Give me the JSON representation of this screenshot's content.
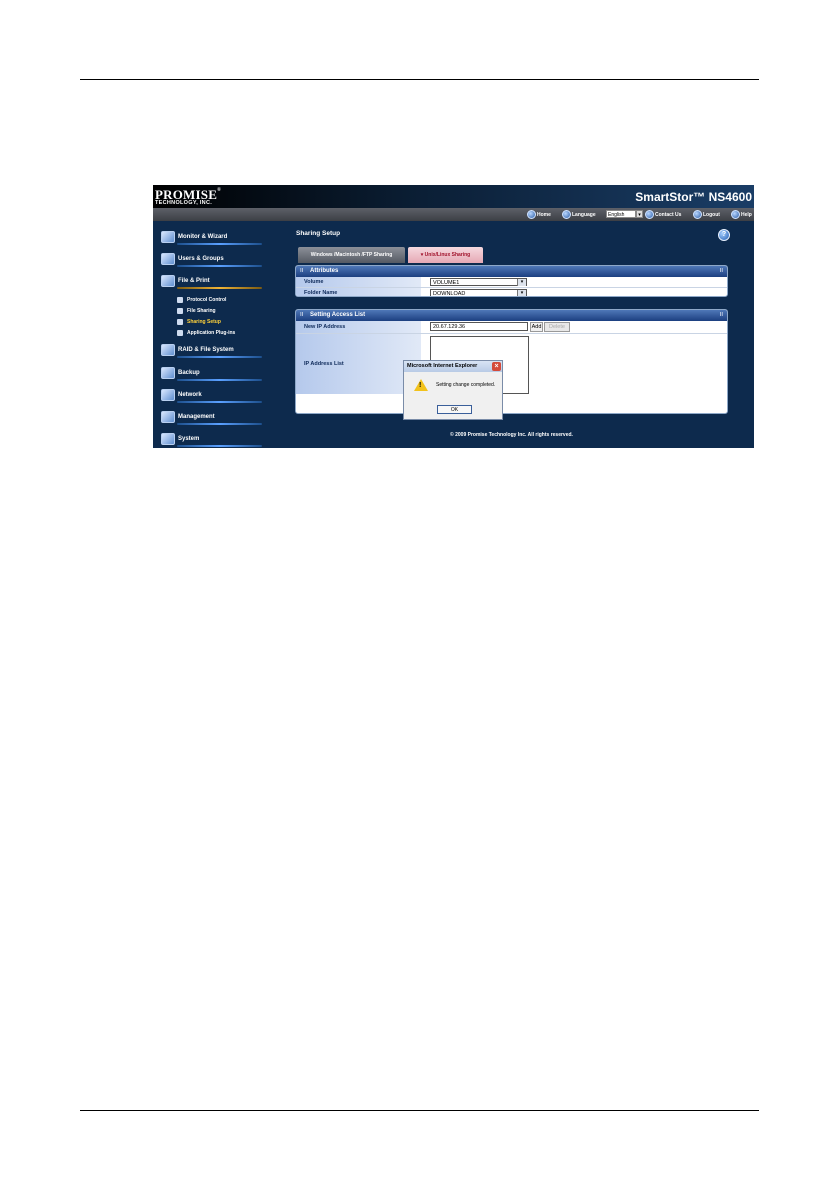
{
  "header": {
    "logo_line1": "PROMISE",
    "logo_mark": "®",
    "logo_line2": "TECHNOLOGY, INC.",
    "product": "SmartStor™ NS4600"
  },
  "topnav": {
    "home": "Home",
    "language_label": "Language",
    "language_value": "English",
    "contact": "Contact Us",
    "logout": "Logout",
    "help": "Help"
  },
  "sidebar": {
    "categories": [
      {
        "label": "Monitor & Wizard"
      },
      {
        "label": "Users & Groups"
      },
      {
        "label": "File & Print"
      },
      {
        "label": "RAID & File System"
      },
      {
        "label": "Backup"
      },
      {
        "label": "Network"
      },
      {
        "label": "Management"
      },
      {
        "label": "System"
      }
    ],
    "file_print_items": [
      {
        "label": "Protocol Control"
      },
      {
        "label": "File Sharing"
      },
      {
        "label": "Sharing Setup"
      },
      {
        "label": "Application Plug-ins"
      }
    ]
  },
  "page": {
    "title": "Sharing Setup",
    "tabs": [
      {
        "label": "Windows /Macintosh /FTP Sharing"
      },
      {
        "label": "Unix/Linux Sharing"
      }
    ],
    "active_tab_marker": "▾"
  },
  "attributes": {
    "header": "Attributes",
    "volume_label": "Volume",
    "volume_value": "VOLUME1",
    "folder_label": "Folder Name",
    "folder_value": "DOWNLOAD"
  },
  "access_list": {
    "header": "Setting Access List",
    "new_ip_label": "New IP Address",
    "new_ip_value": "20.67.129.36",
    "add_button": "Add",
    "delete_button": "Delete",
    "ip_list_label": "IP Address List"
  },
  "dialog": {
    "title": "Microsoft Internet Explorer",
    "message": "Setting change completed.",
    "ok_button": "OK"
  },
  "footer": {
    "copyright": "© 2009 Promise Technology Inc. All rights reserved."
  }
}
